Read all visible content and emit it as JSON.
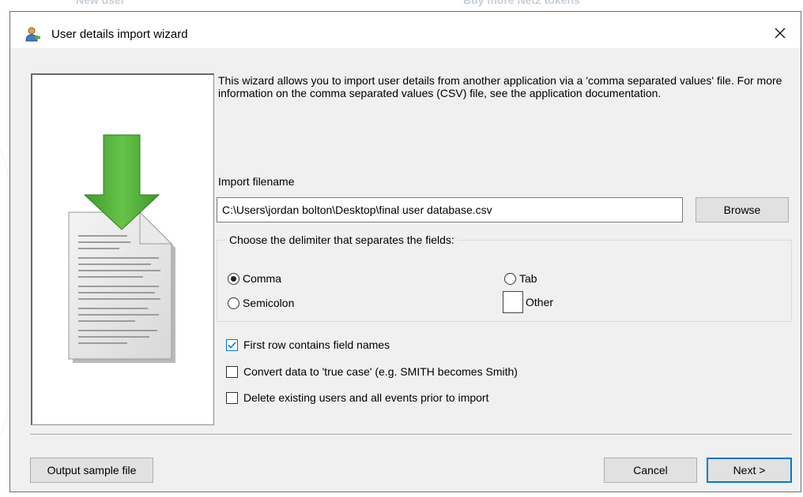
{
  "background": {
    "left_text": "New user",
    "right_text": "Buy more Net2 tokens"
  },
  "dialog": {
    "title": "User details import wizard",
    "title_icon": "user-import-icon",
    "close_glyph": "✕"
  },
  "intro_text": "This wizard allows you to import user details from another application via a 'comma separated values' file. For more information on the comma separated values (CSV) file, see the application documentation.",
  "import": {
    "label": "Import filename",
    "value": "C:\\Users\\jordan bolton\\Desktop\\final user database.csv",
    "browse_label": "Browse"
  },
  "delimiter": {
    "legend": "Choose the delimiter that separates the fields:",
    "options": [
      {
        "label": "Comma",
        "selected": true
      },
      {
        "label": "Tab",
        "selected": false
      },
      {
        "label": "Semicolon",
        "selected": false
      },
      {
        "label": "Other",
        "selected": false
      }
    ]
  },
  "options": [
    {
      "label": "First row contains field names",
      "checked": true
    },
    {
      "label": "Convert data to 'true case' (e.g. SMITH becomes Smith)",
      "checked": false
    },
    {
      "label": "Delete existing users and all events prior to import",
      "checked": false
    }
  ],
  "buttons": {
    "sample": "Output sample file",
    "cancel": "Cancel",
    "next": "Next >"
  },
  "colors": {
    "accent": "#0078d7",
    "arrow_green": "#4caf34",
    "dialog_bg": "#f0f0f0"
  }
}
